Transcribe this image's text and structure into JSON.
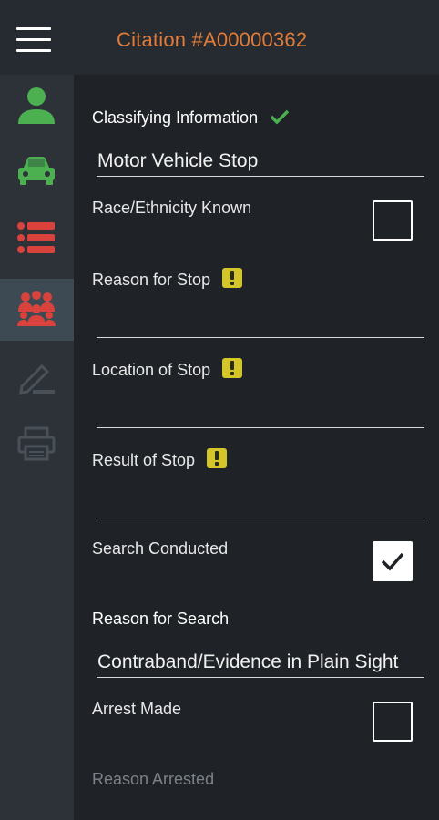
{
  "header": {
    "title": "Citation #A00000362",
    "menu_icon": "hamburger-menu-icon"
  },
  "sidebar": {
    "items": [
      {
        "name": "person",
        "icon": "person-icon",
        "color": "#4caf50"
      },
      {
        "name": "vehicle",
        "icon": "car-icon",
        "color": "#4caf50"
      },
      {
        "name": "list",
        "icon": "list-icon",
        "color": "#d9433c"
      },
      {
        "name": "group",
        "icon": "group-icon",
        "color": "#d9433c",
        "active": true
      },
      {
        "name": "sign",
        "icon": "pencil-sign-icon",
        "color": "#4a5058"
      },
      {
        "name": "print",
        "icon": "printer-icon",
        "color": "#4a5058"
      }
    ]
  },
  "form": {
    "classifying_label": "Classifying Information",
    "classifying_value": "Motor Vehicle Stop",
    "race_label": "Race/Ethnicity Known",
    "race_checked": false,
    "reason_stop_label": "Reason for Stop",
    "reason_stop_value": "",
    "location_label": "Location of Stop",
    "location_value": "",
    "result_label": "Result of Stop",
    "result_value": "",
    "search_label": "Search Conducted",
    "search_checked": true,
    "reason_search_label": "Reason for Search",
    "reason_search_value": "Contraband/Evidence in Plain Sight",
    "arrest_label": "Arrest Made",
    "arrest_checked": false,
    "reason_arrested_label": "Reason Arrested"
  },
  "colors": {
    "accent": "#e07b39",
    "warning": "#d4c52a",
    "ok": "#4caf50",
    "alert": "#d9433c"
  }
}
